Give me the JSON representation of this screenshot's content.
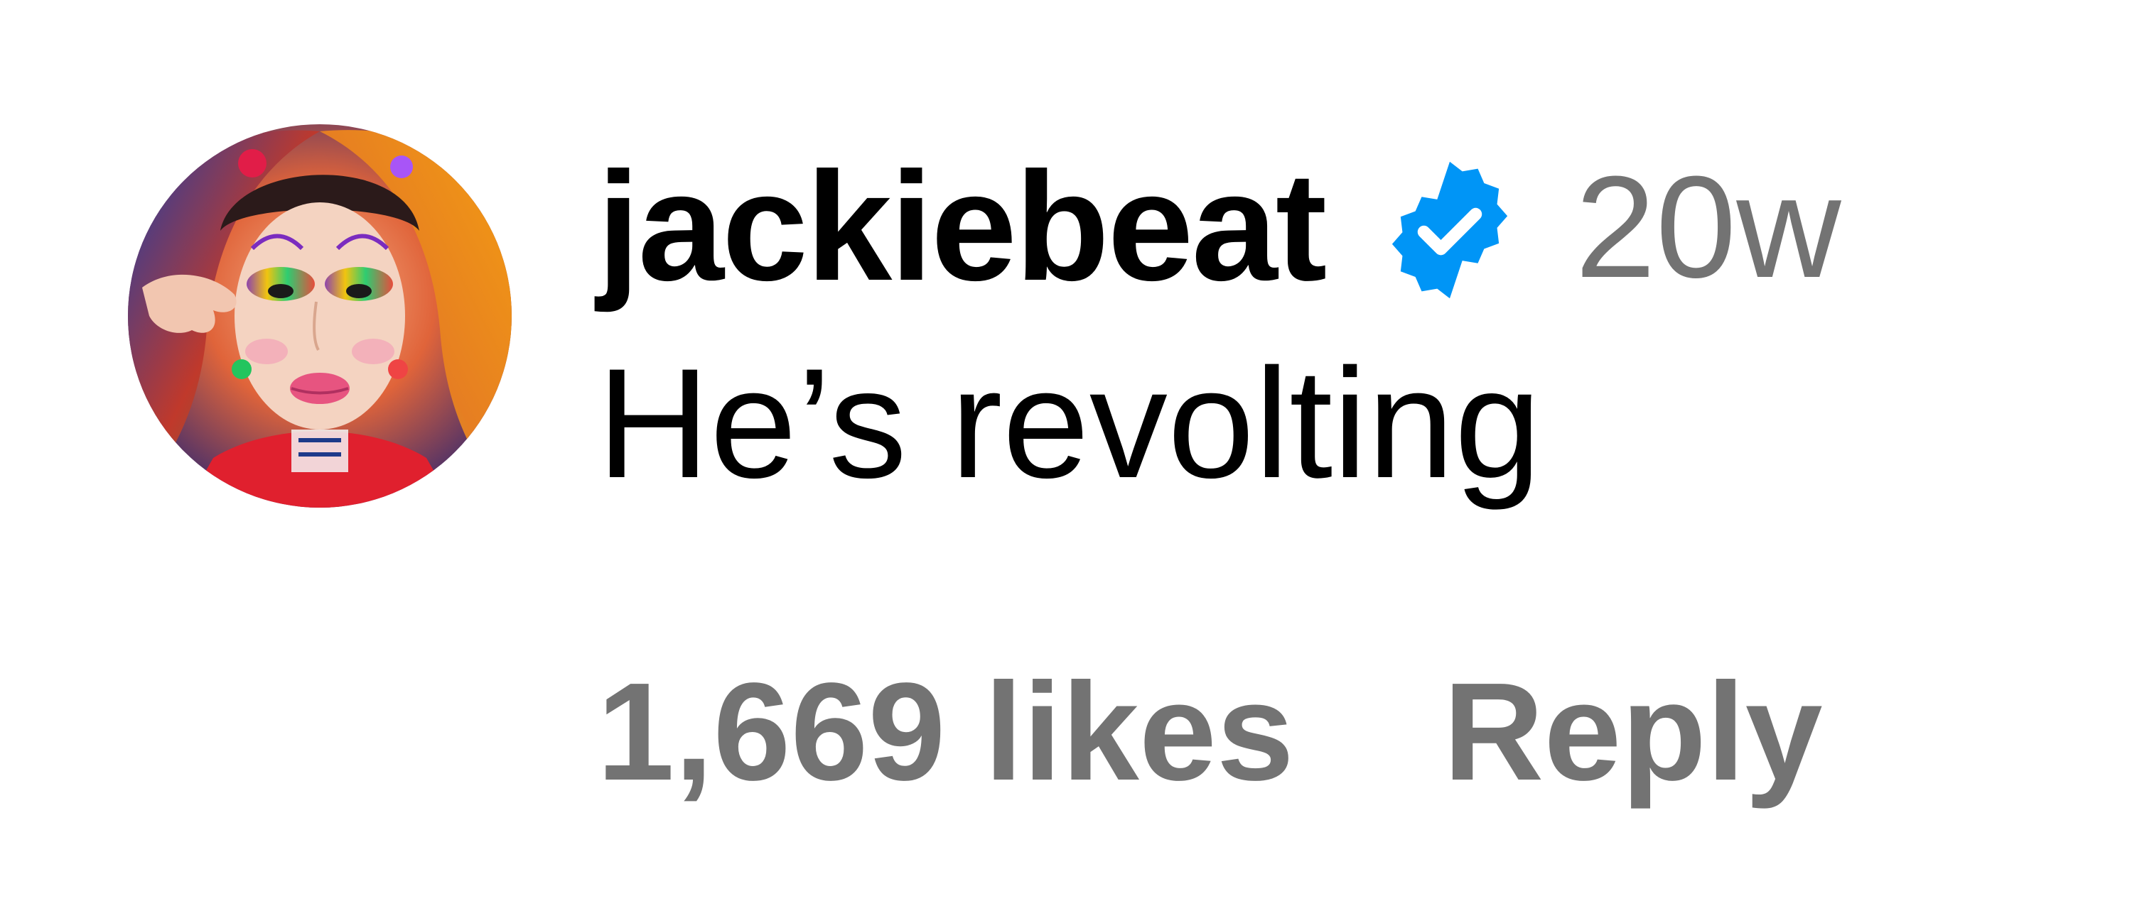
{
  "comment": {
    "username": "jackiebeat",
    "verified": true,
    "timestamp": "20w",
    "text": "He’s revolting",
    "likes_label": "1,669 likes",
    "reply_label": "Reply"
  },
  "icons": {
    "avatar": "profile-photo",
    "verified": "verified-badge-icon"
  },
  "colors": {
    "username": "#000000",
    "text": "#000000",
    "meta": "#737373",
    "verified_badge": "#0095f6",
    "background": "#ffffff"
  }
}
